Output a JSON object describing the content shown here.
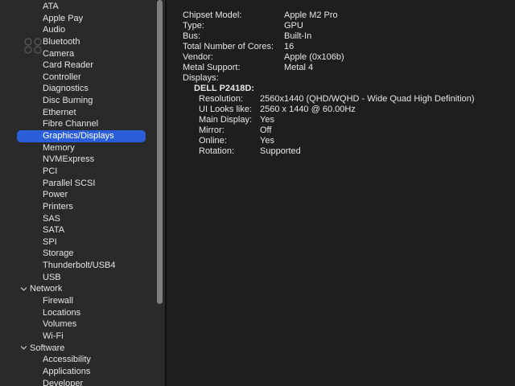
{
  "sidebar": {
    "hardware_items": [
      "ATA",
      "Apple Pay",
      "Audio",
      "Bluetooth",
      "Camera",
      "Card Reader",
      "Controller",
      "Diagnostics",
      "Disc Burning",
      "Ethernet",
      "Fibre Channel",
      "Graphics/Displays",
      "Memory",
      "NVMExpress",
      "PCI",
      "Parallel SCSI",
      "Power",
      "Printers",
      "SAS",
      "SATA",
      "SPI",
      "Storage",
      "Thunderbolt/USB4",
      "USB"
    ],
    "selected_item": "Graphics/Displays",
    "network": {
      "label": "Network",
      "items": [
        "Firewall",
        "Locations",
        "Volumes",
        "Wi-Fi"
      ]
    },
    "software": {
      "label": "Software",
      "items": [
        "Accessibility",
        "Applications",
        "Developer"
      ]
    }
  },
  "details": {
    "rows": [
      {
        "label": "Chipset Model:",
        "value": "Apple M2 Pro"
      },
      {
        "label": "Type:",
        "value": "GPU"
      },
      {
        "label": "Bus:",
        "value": "Built-In"
      },
      {
        "label": "Total Number of Cores:",
        "value": "16"
      },
      {
        "label": "Vendor:",
        "value": "Apple (0x106b)"
      },
      {
        "label": "Metal Support:",
        "value": "Metal 4"
      }
    ],
    "displays_label": "Displays:",
    "display_name": "DELL P2418D:",
    "display_rows": [
      {
        "label": "Resolution:",
        "value": "2560x1440 (QHD/WQHD - Wide Quad High Definition)"
      },
      {
        "label": "UI Looks like:",
        "value": "2560 x 1440 @ 60.00Hz"
      },
      {
        "label": "Main Display:",
        "value": "Yes"
      },
      {
        "label": "Mirror:",
        "value": "Off"
      },
      {
        "label": "Online:",
        "value": "Yes"
      },
      {
        "label": "Rotation:",
        "value": "Supported"
      }
    ]
  },
  "colors": {
    "selection": "#2b5fd9",
    "sidebar_bg": "#2a2a2b",
    "content_bg": "#1e1e1e"
  },
  "icons": {
    "chevron": "chevron-down-icon",
    "watermark": "watermark-icon"
  }
}
